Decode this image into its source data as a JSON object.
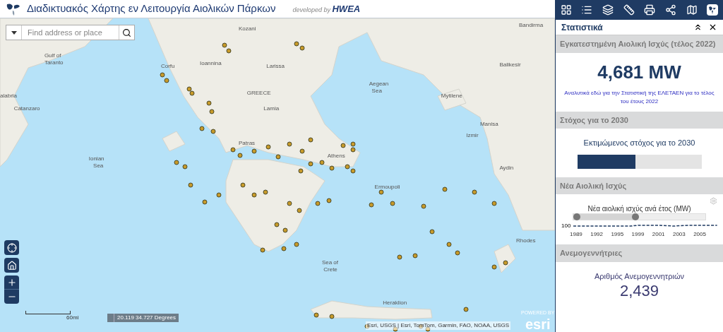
{
  "header": {
    "title": "Διαδικτυακός Χάρτης εν Λειτουργία Αιολικών Πάρκων",
    "developer_prefix": "developed by",
    "developer": "HWEA"
  },
  "search": {
    "placeholder": "Find address or place"
  },
  "map_labels": [
    "Kozani",
    "Bandirma",
    "Gulf of",
    "Taranto",
    "Corfu",
    "Ioannina",
    "Larissa",
    "Balikesir",
    "alabria",
    "Aegean",
    "Sea",
    "GREECE",
    "Mytilene",
    "Catanzaro",
    "Lamia",
    "Manisa",
    "Izmir",
    "Patras",
    "Athens",
    "Ionian",
    "Sea",
    "Aydin",
    "Ermoupoli",
    "Rhodes",
    "Sea of",
    "Crete",
    "Heraklion"
  ],
  "scale": {
    "label": "60mi"
  },
  "coordinates": {
    "text": "20.119 34.727 Degrees"
  },
  "attribution": "Esri, USGS | Esri, TomTom, Garmin, FAO, NOAA, USGS",
  "esri_logo": {
    "powered_by": "POWERED BY",
    "name": "esri"
  },
  "panel": {
    "title": "Στατιστικά",
    "installed": {
      "heading": "Εγκατεστημένη Αιολική Ισχύς (τέλος 2022)",
      "value": "4,681 MW",
      "link": "Αναλυτικά εδώ για την Στατιστική της ΕΛΕΤΑΕΝ για το τέλος του έτους 2022"
    },
    "target": {
      "heading": "Στόχος για το 2030",
      "label": "Εκτιμώμενος στόχος για το 2030",
      "level": 0.47
    },
    "new_power": {
      "heading": "Νέα Αιολική Ισχύς",
      "chart_title": "Νέα αιολική ισχύς ανά έτος (MW)",
      "axis_value": "100",
      "slider": {
        "level": 0.47
      },
      "years": [
        "1989",
        "1992",
        "1995",
        "1999",
        "2001",
        "2003",
        "2005"
      ]
    },
    "turbines": {
      "heading": "Ανεμογεννήτριες",
      "label": "Αριθμός Ανεμογεννητριών",
      "value": "2,439"
    }
  }
}
